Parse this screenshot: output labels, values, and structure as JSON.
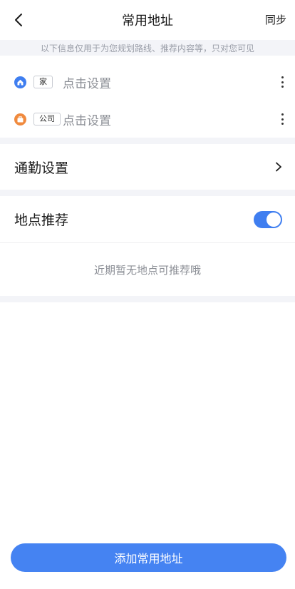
{
  "header": {
    "title": "常用地址",
    "sync_label": "同步",
    "back_icon": "chevron-left-icon"
  },
  "notice": "以下信息仅用于为您规划路线、推荐内容等，只对您可见",
  "addresses": [
    {
      "tag": "家",
      "hint": "点击设置",
      "icon": "home-icon",
      "color": "#3f7ef0"
    },
    {
      "tag": "公司",
      "hint": "点击设置",
      "icon": "briefcase-icon",
      "color": "#f08a3e"
    }
  ],
  "commute": {
    "label": "通勤设置",
    "icon": "chevron-right-icon"
  },
  "recommend": {
    "label": "地点推荐",
    "toggle_on": true,
    "empty_text": "近期暂无地点可推荐哦"
  },
  "add_button": "添加常用地址",
  "colors": {
    "accent": "#3f7ef0",
    "divider_bg": "#f3f4f8"
  }
}
